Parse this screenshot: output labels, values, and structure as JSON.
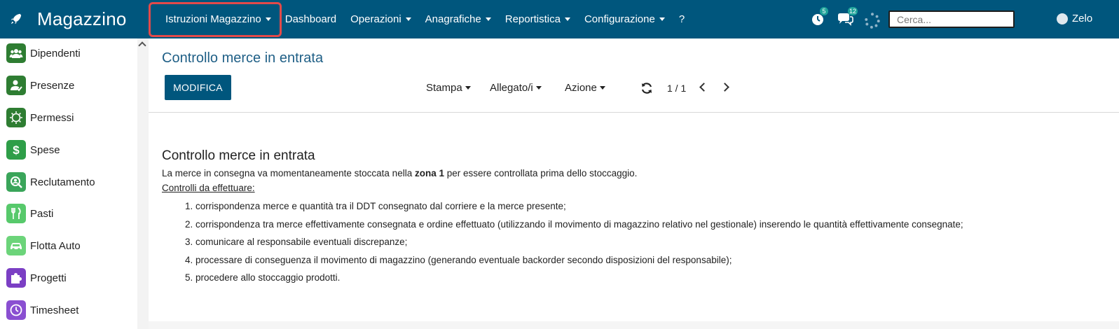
{
  "app": {
    "name": "Magazzino"
  },
  "nav": {
    "items": [
      {
        "label": "Istruzioni Magazzino",
        "dropdown": true
      },
      {
        "label": "Dashboard",
        "dropdown": false
      },
      {
        "label": "Operazioni",
        "dropdown": true
      },
      {
        "label": "Anagrafiche",
        "dropdown": true
      },
      {
        "label": "Reportistica",
        "dropdown": true
      },
      {
        "label": "Configurazione",
        "dropdown": true
      },
      {
        "label": "?",
        "dropdown": false
      }
    ],
    "activity_count": "5",
    "messages_count": "12",
    "search_placeholder": "Cerca...",
    "user_name": "Zelo"
  },
  "sidebar": {
    "items": [
      {
        "label": "Dipendenti",
        "icon": "users-icon",
        "color": "#2e7d32"
      },
      {
        "label": "Presenze",
        "icon": "user-check-icon",
        "color": "#2e7d32"
      },
      {
        "label": "Permessi",
        "icon": "sun-icon",
        "color": "#2e7d32"
      },
      {
        "label": "Spese",
        "icon": "dollar-icon",
        "color": "#2e9e48"
      },
      {
        "label": "Reclutamento",
        "icon": "user-search-icon",
        "color": "#3aa55a"
      },
      {
        "label": "Pasti",
        "icon": "cutlery-icon",
        "color": "#57c96b"
      },
      {
        "label": "Flotta Auto",
        "icon": "car-icon",
        "color": "#6cd47a"
      },
      {
        "label": "Progetti",
        "icon": "puzzle-icon",
        "color": "#7b3fc4"
      },
      {
        "label": "Timesheet",
        "icon": "clock-icon",
        "color": "#8a4fd1"
      }
    ]
  },
  "page": {
    "title": "Controllo merce in entrata",
    "edit_button": "MODIFICA",
    "actions": [
      "Stampa",
      "Allegato/i",
      "Azione"
    ],
    "pager": "1 / 1"
  },
  "content": {
    "title": "Controllo merce in entrata",
    "intro_before": "La merce in consegna va momentaneamente stoccata nella ",
    "intro_bold": "zona 1",
    "intro_after": " per essere controllata prima dello stoccaggio.",
    "subtitle": "Controlli da effettuare:",
    "list": [
      "1. corrispondenza merce e quantità tra il DDT consegnato dal corriere e la merce presente;",
      "2. corrispondenza tra merce effettivamente consegnata e ordine effettuato (utilizzando il movimento di magazzino relativo nel gestionale) inserendo le quantità effettivamente consegnate;",
      "3. comunicare al responsabile eventuali discrepanze;",
      "4.  processare di conseguenza il movimento di magazzino (generando eventuale backorder secondo disposizioni del responsabile);",
      "5. procedere allo stoccaggio prodotti."
    ]
  },
  "colors": {
    "navbar": "#00567d",
    "title": "#1f5f86",
    "highlight": "#e24a4a",
    "badge": "#1fa39a"
  }
}
